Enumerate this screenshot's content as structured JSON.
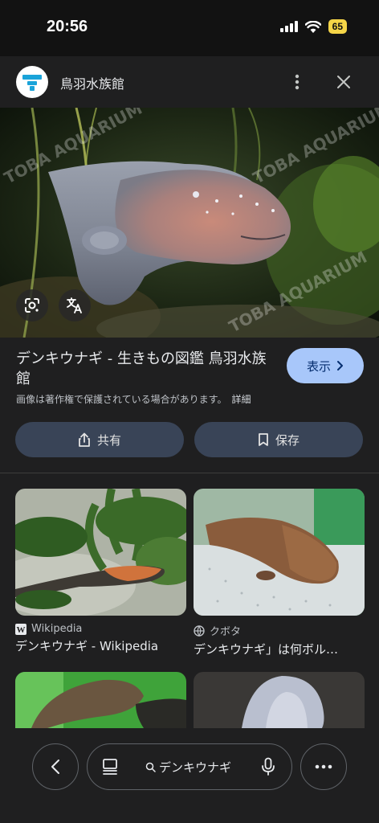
{
  "status": {
    "time": "20:56",
    "battery": "65"
  },
  "header": {
    "site_name": "鳥羽水族館"
  },
  "hero": {
    "watermark": "TOBA AQUARIUM"
  },
  "result": {
    "title": "デンキウナギ - 生きもの図鑑 鳥羽水族館",
    "view_label": "表示",
    "copyright": "画像は著作権で保護されている場合があります。",
    "details_label": "詳細"
  },
  "actions": {
    "share_label": "共有",
    "save_label": "保存"
  },
  "related": [
    {
      "source": "Wikipedia",
      "title": "デンキウナギ - Wikipedia"
    },
    {
      "source": "クボタ",
      "title": "デンキウナギ」は何ボル…"
    },
    {
      "source": "",
      "title": ""
    },
    {
      "source": "",
      "title": ""
    }
  ],
  "search": {
    "query": "デンキウナギ"
  },
  "colors": {
    "accent": "#a8c7fa",
    "button_bg": "#394457",
    "background": "#1f1f20"
  }
}
